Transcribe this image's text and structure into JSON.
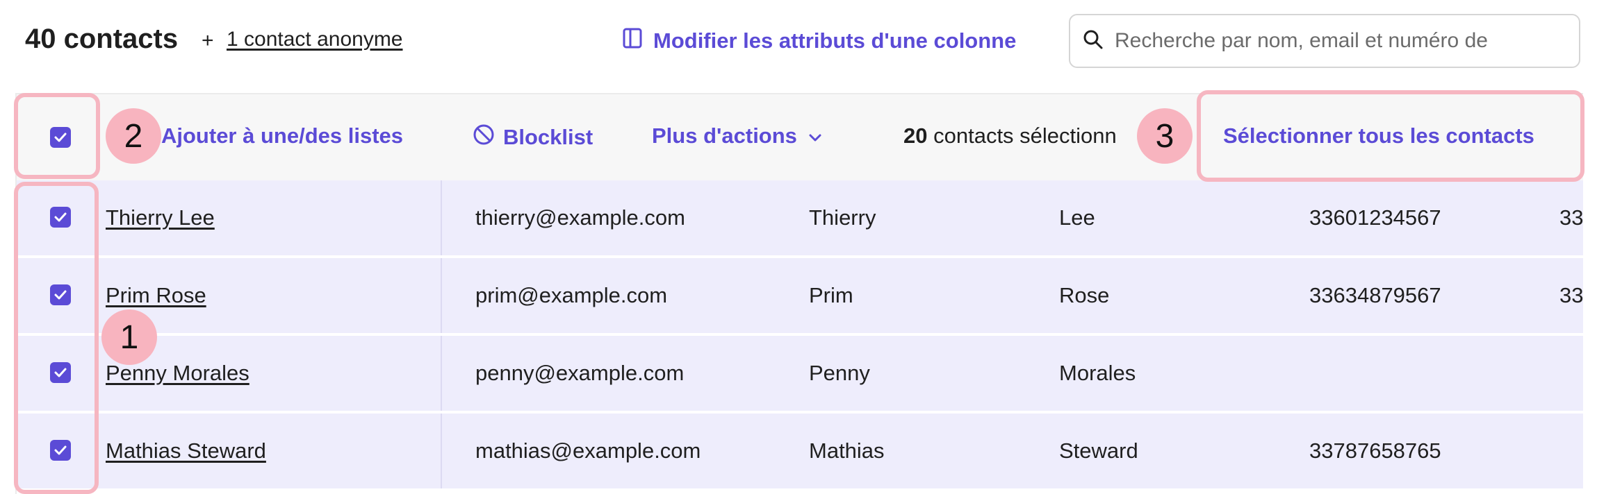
{
  "header": {
    "contacts_count": "40 contacts",
    "plus": "+",
    "anonymous_link": "1 contact anonyme",
    "modify_columns": "Modifier les attributs d'une colonne",
    "search_placeholder": "Recherche par nom, email et numéro de"
  },
  "action_bar": {
    "select_all_checked": true,
    "add_to_lists": "Ajouter à une/des listes",
    "blocklist": "Blocklist",
    "more_actions": "Plus d'actions",
    "selected_count": "20",
    "selected_text": "contacts sélectionn",
    "select_all_contacts": "Sélectionner tous les contacts"
  },
  "rows": [
    {
      "name": "Thierry Lee",
      "email": "thierry@example.com",
      "first": "Thierry",
      "last": "Lee",
      "phone": "33601234567",
      "extra": "33",
      "checked": true
    },
    {
      "name": "Prim Rose",
      "email": "prim@example.com",
      "first": "Prim",
      "last": "Rose",
      "phone": "33634879567",
      "extra": "33",
      "checked": true
    },
    {
      "name": "Penny Morales",
      "email": "penny@example.com",
      "first": "Penny",
      "last": "Morales",
      "phone": "",
      "extra": "",
      "checked": true
    },
    {
      "name": "Mathias Steward",
      "email": "mathias@example.com",
      "first": "Mathias",
      "last": "Steward",
      "phone": "33787658765",
      "extra": "",
      "checked": true
    }
  ],
  "annotations": [
    {
      "label": "1"
    },
    {
      "label": "2"
    },
    {
      "label": "3"
    }
  ],
  "colors": {
    "accent": "#5b4bd6",
    "row_selected_bg": "#eeedfc",
    "annotation": "#f6b6c1"
  }
}
